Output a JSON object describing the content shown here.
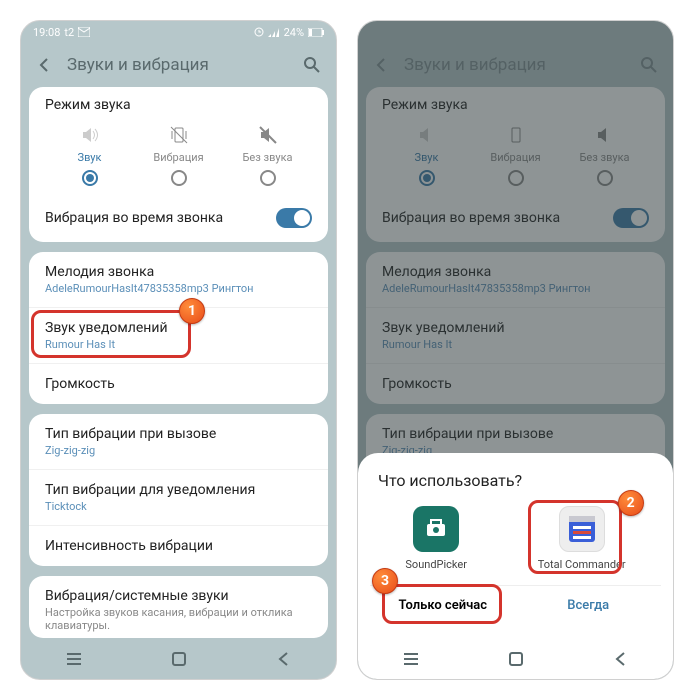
{
  "status": {
    "time": "19:08",
    "carrier": "t2",
    "battery": "24%"
  },
  "header": {
    "title": "Звуки и вибрация"
  },
  "soundMode": {
    "title": "Режим звука",
    "options": [
      {
        "label": "Звук",
        "selected": true
      },
      {
        "label": "Вибрация",
        "selected": false
      },
      {
        "label": "Без звука",
        "selected": false
      }
    ]
  },
  "vibrateCall": {
    "title": "Вибрация во время звонка"
  },
  "ringtone": {
    "title": "Мелодия звонка",
    "sub": "AdeleRumourHasIt47835358mp3 Рингтон"
  },
  "notification": {
    "title": "Звук уведомлений",
    "sub": "Rumour Has It"
  },
  "volume": {
    "title": "Громкость"
  },
  "vibTypeCall": {
    "title": "Тип вибрации при вызове",
    "sub": "Zig-zig-zig"
  },
  "vibTypeNotif": {
    "title": "Тип вибрации для уведомления",
    "sub": "Ticktock"
  },
  "vibIntensity": {
    "title": "Интенсивность вибрации"
  },
  "systemSounds": {
    "title": "Вибрация/системные звуки",
    "sub": "Настройка звуков касания, вибрации и отклика клавиатуры."
  },
  "sheet": {
    "title": "Что использовать?",
    "app1": "SoundPicker",
    "app2": "Total Commander",
    "justOnce": "Только сейчас",
    "always": "Всегда"
  },
  "badges": {
    "b1": "1",
    "b2": "2",
    "b3": "3"
  }
}
